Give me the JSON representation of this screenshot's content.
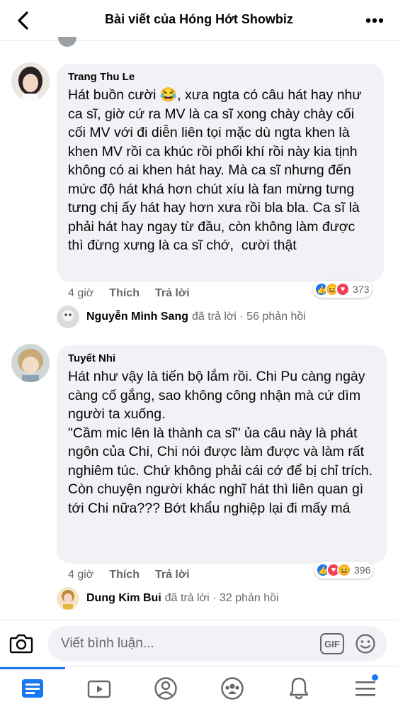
{
  "header": {
    "title": "Bài viết của Hóng Hớt Showbiz",
    "back_icon": "chevron-left-icon",
    "more_icon": "more-horizontal-icon"
  },
  "comments": [
    {
      "author": "Trang Thu Le",
      "text": "Hát buồn cười 😂, xưa ngta có câu hát hay như ca sĩ, giờ cứ ra MV là ca sĩ xong chày chày cối cối MV với đi diễn liên tọi mặc dù ngta khen là khen MV rồi ca khúc rồi phối khí rồi này kia tịnh không có ai khen hát hay. Mà ca sĩ nhưng đến mức độ hát khá hơn chút xíu là fan mừng tưng tưng chị ấy hát hay hơn xưa rồi bla bla. Ca sĩ là phải hát hay ngay từ đầu, còn không làm được thì đừng xưng là ca sĩ chớ,  cười thật",
      "time": "4 giờ",
      "like_label": "Thích",
      "reply_label": "Trả lời",
      "reaction_count": "373",
      "reactions": [
        "like",
        "haha",
        "love"
      ],
      "reply": {
        "name": "Nguyễn Minh Sang",
        "text": "đã trả lời · 56 phản hồi"
      }
    },
    {
      "author": "Tuyết Nhi",
      "text": "Hát như vậy là tiến bộ lắm rồi. Chi Pu càng ngày càng cố gắng, sao không công nhận mà cứ dìm người ta xuống.\n\"Cầm mic lên là thành ca sĩ\" ủa câu này là phát ngôn của Chi, Chi nói được làm được và làm rất nghiêm túc. Chứ không phải cái cớ để bị chỉ trích.\nCòn chuyện người khác nghĩ hát thì liên quan gì tới Chi nữa??? Bớt khẩu nghiệp lại đi mấy má",
      "time": "4 giờ",
      "like_label": "Thích",
      "reply_label": "Trả lời",
      "reaction_count": "396",
      "reactions": [
        "like",
        "love",
        "haha"
      ],
      "reply": {
        "name": "Dung Kim Bui",
        "text": "đã trả lời · 32 phản hồi"
      }
    }
  ],
  "composer": {
    "placeholder": "Viết bình luận...",
    "gif_label": "GIF",
    "camera_icon": "camera-icon",
    "emoji_icon": "smiley-icon"
  },
  "nav": {
    "items": [
      "news-feed-icon",
      "watch-icon",
      "profile-icon",
      "groups-icon",
      "notifications-icon",
      "menu-icon"
    ],
    "active": "news-feed-icon"
  },
  "colors": {
    "accent": "#1877f2",
    "bubble": "#f0f2f5",
    "secondary_text": "#65676b",
    "love": "#f33e58",
    "haha": "#f7b125"
  }
}
